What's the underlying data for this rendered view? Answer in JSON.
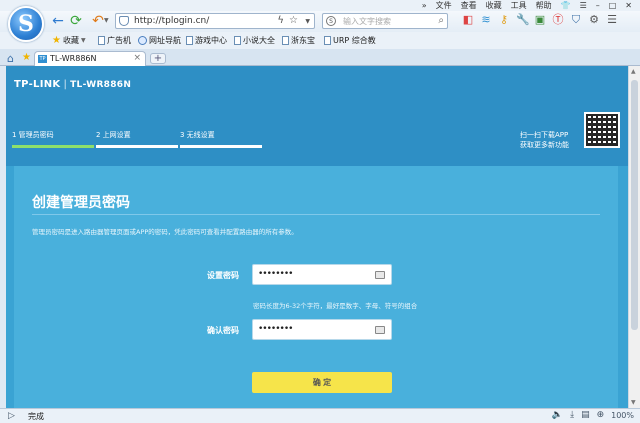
{
  "browser": {
    "menu": {
      "overflow": "»",
      "items": [
        "文件",
        "查看",
        "收藏",
        "工具",
        "帮助"
      ]
    },
    "address_bar": {
      "url": "http://tplogin.cn/"
    },
    "search": {
      "engine_glyph": "S",
      "placeholder": "输入文字搜索"
    },
    "favorites": [
      {
        "label": "收藏",
        "icon": "star-icon"
      },
      {
        "label": "广告机",
        "icon": "page-icon"
      },
      {
        "label": "网址导航",
        "icon": "globe-icon"
      },
      {
        "label": "游戏中心",
        "icon": "page-icon"
      },
      {
        "label": "小说大全",
        "icon": "page-icon"
      },
      {
        "label": "浙东宝",
        "icon": "page-icon"
      },
      {
        "label": "URP 综合教",
        "icon": "page-icon"
      }
    ],
    "tab": {
      "favicon_text": "TP",
      "title": "TL-WR886N"
    },
    "status": {
      "text": "完成",
      "zoom": "100%"
    },
    "logo_glyph": "S",
    "colors": {
      "chrome": "#eaf1f8",
      "accent": "#2d7fd3"
    }
  },
  "router": {
    "brand": "TP-LINK",
    "model": "TL-WR886N",
    "steps": [
      {
        "label": "1 管理员密码",
        "active": true
      },
      {
        "label": "2 上网设置",
        "active": false
      },
      {
        "label": "3 无线设置",
        "active": false
      }
    ],
    "qr": {
      "line1": "扫一扫下载APP",
      "line2": "获取更多新功能"
    },
    "content": {
      "title": "创建管理员密码",
      "description": "管理员密码是进入路由器管理页面或APP的密码，凭此密码可查看并配置路由器的所有参数。",
      "password_label": "设置密码",
      "password_value": "••••••••",
      "hint": "密码长度为6-32个字符，最好是数字、字母、符号的组合",
      "confirm_label": "确认密码",
      "confirm_value": "••••••••",
      "submit_label": "确 定"
    },
    "colors": {
      "header": "#2e8fc5",
      "panel": "#49b0dc",
      "step_active": "#8ee06b",
      "button": "#f6e44a"
    }
  }
}
